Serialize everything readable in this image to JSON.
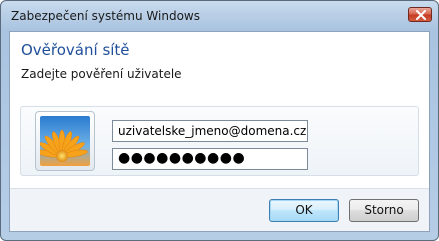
{
  "window": {
    "title": "Zabezpečení systému Windows"
  },
  "dialog": {
    "heading": "Ověřování sítě",
    "subheading": "Zadejte pověření uživatele",
    "username_value": "uzivatelske_jmeno@domena.cz",
    "password_mask": "●●●●●●●●●●"
  },
  "buttons": {
    "ok_label": "OK",
    "cancel_label": "Storno"
  },
  "icons": {
    "close": "close-icon",
    "avatar": "user-flower-picture"
  },
  "colors": {
    "heading": "#1f4f9a",
    "close_button": "#c43b22",
    "default_button_border": "#3c7fb1"
  }
}
